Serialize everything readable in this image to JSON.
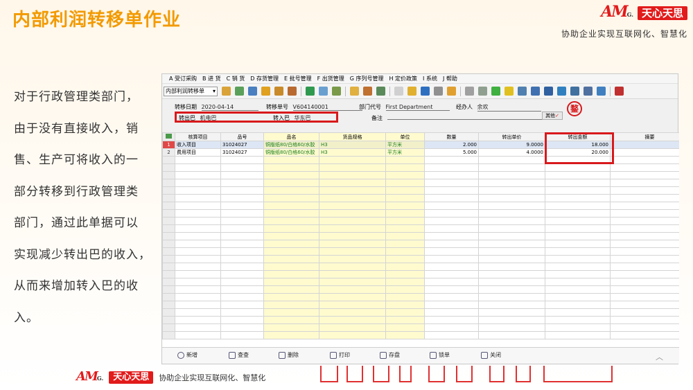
{
  "slide": {
    "title": "内部利润转移单作业",
    "brand_logo": "AM",
    "brand_logo_suffix": "G.",
    "brand_name": "天心天思",
    "brand_slogan": "协助企业实现互联网化、智慧化",
    "body_lines": [
      "对于行政管理类部门，",
      "由于没有直接收入，销",
      "售、生产可将收入的一",
      "部分转移到行政管理类",
      "部门，通过此单据可以",
      "实现减少转出巴的收入，",
      "从而来增加转入巴的收",
      "入。"
    ],
    "bottom_logo": "AM",
    "bottom_logo_suffix": "G.",
    "bottom_brand": "天心天思",
    "bottom_slogan": "协助企业实现互联网化、智慧化"
  },
  "app": {
    "menu": [
      "A 受订采购",
      "B 进  货",
      "C 销  货",
      "D 存货管理",
      "E 批号管理",
      "F 出货管理",
      "G 序列号管理",
      "H 定价政策",
      "I 系统",
      "J 帮助"
    ],
    "doc_type": "内部利润转移单",
    "toolbar_icons": [
      {
        "name": "user-group-icon",
        "color": "#d9a33a"
      },
      {
        "name": "phone-icon",
        "color": "#5aa05a"
      },
      {
        "name": "monitor-icon",
        "color": "#4a7fc0"
      },
      {
        "name": "lock-icon",
        "color": "#e0a020"
      },
      {
        "name": "briefcase-icon",
        "color": "#c98a2a"
      },
      {
        "name": "home-icon",
        "color": "#b96a30"
      },
      {
        "name": "sep",
        "color": ""
      },
      {
        "name": "money-icon",
        "color": "#2f9a4f"
      },
      {
        "name": "cart-icon",
        "color": "#6aa0d0"
      },
      {
        "name": "shopping-cart-icon",
        "color": "#7a9a4a"
      },
      {
        "name": "sep",
        "color": ""
      },
      {
        "name": "clipboard-icon",
        "color": "#e0b040"
      },
      {
        "name": "people-icon",
        "color": "#c07030"
      },
      {
        "name": "transfer-icon",
        "color": "#5a8a5a"
      },
      {
        "name": "sep",
        "color": ""
      },
      {
        "name": "help-doc-icon",
        "color": "#d0d0d0"
      },
      {
        "name": "mail-icon",
        "color": "#e0b030"
      },
      {
        "name": "info-icon",
        "color": "#2f6fc0"
      },
      {
        "name": "calculator-icon",
        "color": "#909090"
      },
      {
        "name": "folder-icon",
        "color": "#e0a030"
      },
      {
        "name": "sep",
        "color": ""
      },
      {
        "name": "book-icon",
        "color": "#a0a0a0"
      },
      {
        "name": "settings-icon",
        "color": "#90a090"
      },
      {
        "name": "check-icon",
        "color": "#40b040"
      },
      {
        "name": "bell-icon",
        "color": "#e0c020"
      },
      {
        "name": "search-icon",
        "color": "#5080b0"
      },
      {
        "name": "org-chart-icon",
        "color": "#4070b0"
      },
      {
        "name": "screen-icon",
        "color": "#3060a0"
      },
      {
        "name": "refresh-icon",
        "color": "#3080c0"
      },
      {
        "name": "window-icon",
        "color": "#4070a0"
      },
      {
        "name": "close-window-icon",
        "color": "#5070a0"
      },
      {
        "name": "image-icon",
        "color": "#4080c0"
      },
      {
        "name": "sep",
        "color": ""
      },
      {
        "name": "exit-icon",
        "color": "#c03030"
      }
    ],
    "header": {
      "date_label": "转移日期",
      "date_value": "2020-04-14",
      "docno_label": "转移单号",
      "docno_value": "V604140001",
      "dept_label": "部门代号",
      "dept_value": "First Department",
      "handler_label": "经办人",
      "handler_value": "余欢",
      "out_label": "转出巴",
      "out_value": "机电巴",
      "in_label": "转入巴",
      "in_value": "华东巴",
      "remark_label": "备注",
      "other_label": "其他",
      "other_check": "✓",
      "stamp": "鍪"
    },
    "table": {
      "columns": [
        "核算项目",
        "品号",
        "品名",
        "货品规格",
        "单位",
        "数量",
        "转出单价",
        "转出金额",
        "摘要"
      ],
      "rows": [
        {
          "no": "1",
          "item": "收入项目",
          "code": "31024027",
          "name": "铜版纸80/白格60/水胶",
          "spec": "H3",
          "unit": "平方米",
          "qty": "2.000",
          "price": "9.0000",
          "amount": "18.000",
          "memo": ""
        },
        {
          "no": "2",
          "item": "费用项目",
          "code": "31024027",
          "name": "铜版纸80/白格60/水胶",
          "spec": "H3",
          "unit": "平方米",
          "qty": "5.000",
          "price": "4.0000",
          "amount": "20.000",
          "memo": ""
        }
      ]
    },
    "footer": {
      "add": "新增",
      "query": "查查",
      "delete": "删除",
      "print": "打印",
      "save": "存盘",
      "lock": "锁单",
      "close": "关闭",
      "collapse": "︿"
    }
  }
}
